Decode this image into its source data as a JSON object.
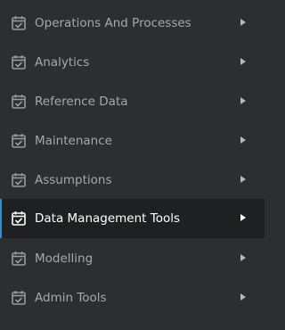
{
  "sidebar": {
    "active_index": 5,
    "accent_color": "#2b8fd6",
    "items": [
      {
        "label": "Operations And Processes",
        "icon": "calendar-check-icon"
      },
      {
        "label": "Analytics",
        "icon": "calendar-check-icon"
      },
      {
        "label": "Reference Data",
        "icon": "calendar-check-icon"
      },
      {
        "label": "Maintenance",
        "icon": "calendar-check-icon"
      },
      {
        "label": "Assumptions",
        "icon": "calendar-check-icon"
      },
      {
        "label": "Data Management Tools",
        "icon": "calendar-check-icon"
      },
      {
        "label": "Modelling",
        "icon": "calendar-check-icon"
      },
      {
        "label": "Admin Tools",
        "icon": "calendar-check-icon"
      }
    ]
  }
}
